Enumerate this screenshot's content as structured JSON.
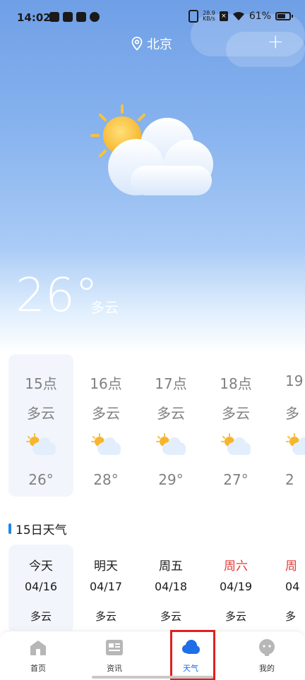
{
  "status_bar": {
    "time": "14:02",
    "net_speed_value": "28.9",
    "net_speed_unit": "KB/s",
    "battery": "61%"
  },
  "header": {
    "city": "北京",
    "add_label": "+"
  },
  "current": {
    "temperature": "26°",
    "condition": "多云"
  },
  "hourly": [
    {
      "time": "15点",
      "condition": "多云",
      "temp": "26°"
    },
    {
      "time": "16点",
      "condition": "多云",
      "temp": "28°"
    },
    {
      "time": "17点",
      "condition": "多云",
      "temp": "29°"
    },
    {
      "time": "18点",
      "condition": "多云",
      "temp": "27°"
    },
    {
      "time": "19",
      "condition": "多",
      "temp": "2"
    }
  ],
  "daily_title": "15日天气",
  "daily": [
    {
      "name": "今天",
      "date": "04/16",
      "condition": "多云"
    },
    {
      "name": "明天",
      "date": "04/17",
      "condition": "多云"
    },
    {
      "name": "周五",
      "date": "04/18",
      "condition": "多云"
    },
    {
      "name": "周六",
      "date": "04/19",
      "condition": "多云"
    },
    {
      "name": "周",
      "date": "04",
      "condition": "多"
    }
  ],
  "tabs": [
    {
      "label": "首页"
    },
    {
      "label": "资讯"
    },
    {
      "label": "天气"
    },
    {
      "label": "我的"
    }
  ],
  "colors": {
    "accent": "#1e6fe8",
    "weekend": "#e53935",
    "highlight": "#e0201e"
  }
}
